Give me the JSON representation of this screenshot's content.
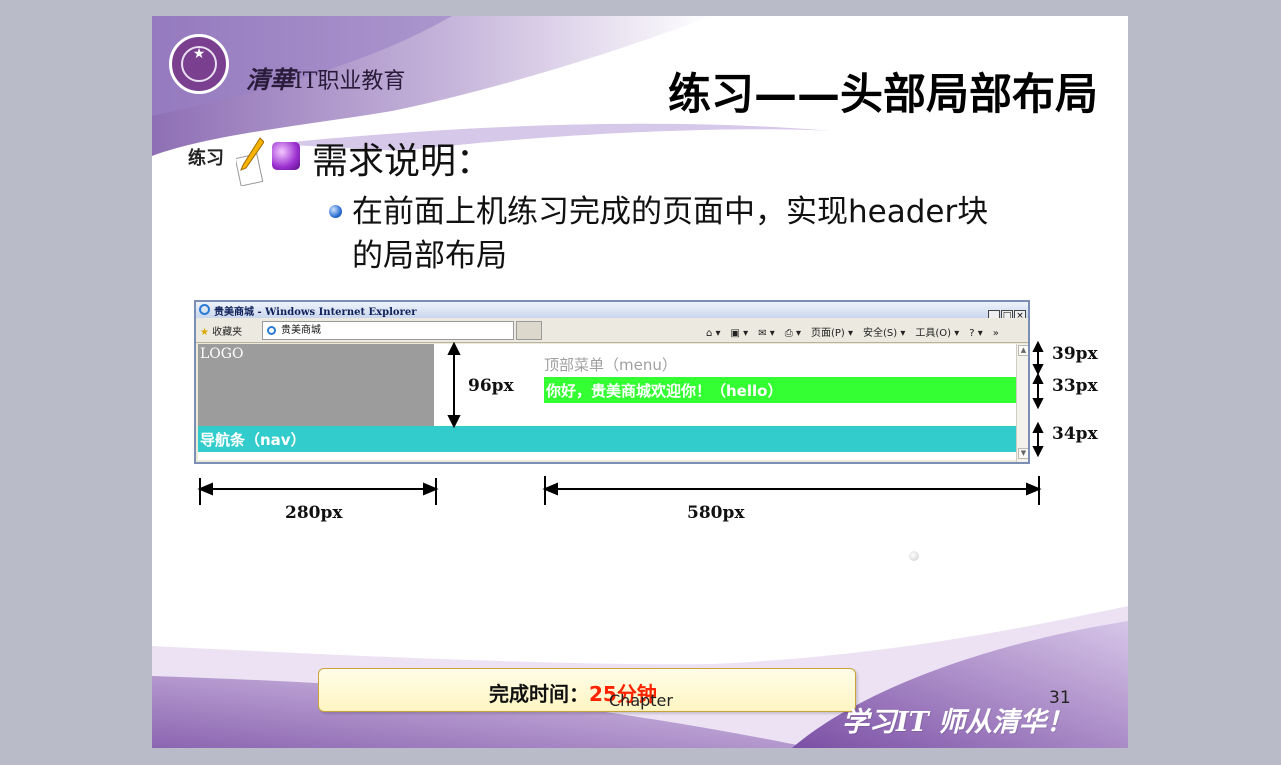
{
  "brand": {
    "script": "清華",
    "rest": "IT职业教育"
  },
  "title": "练习——头部局部布局",
  "exercise_badge": "练习",
  "bullet_lv1": "需求说明：",
  "bullet_lv2": "在前面上机练习完成的页面中，实现header块的局部布局",
  "ie": {
    "window_title": "贵美商城 - Windows Internet Explorer",
    "window_buttons": [
      "_",
      "□",
      "×"
    ],
    "favorites": "收藏夹",
    "tab_label": "贵美商城",
    "toolbar": [
      "页面(P) ▾",
      "安全(S) ▾",
      "工具(O) ▾",
      "»"
    ],
    "logo_block": "LOGO",
    "menu_block": "顶部菜单（menu）",
    "hello_block": "你好，贵美商城欢迎你！（hello）",
    "nav_block": "导航条（nav）"
  },
  "dimensions": {
    "height_96": "96px",
    "h39": "39px",
    "h33": "33px",
    "h34": "34px",
    "w280": "280px",
    "w580": "580px"
  },
  "footer": {
    "time_label": "完成时间：",
    "time_value": "25分钟",
    "chapter": "Chapter",
    "page_number": "31",
    "slogan": "学习IT 师从清华！"
  },
  "colors": {
    "logo_block": "#9c9c9c",
    "hello_block": "#33ff33",
    "nav_block": "#33cccc",
    "time_value": "#ff2200"
  }
}
